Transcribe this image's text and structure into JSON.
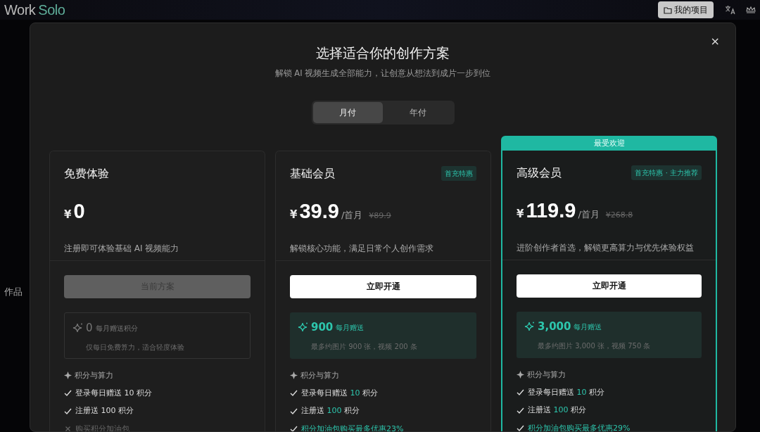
{
  "app": {
    "logo_word_1": "Work",
    "logo_word_2": "Solo",
    "projects_button": "我的项目",
    "side_label": "作品"
  },
  "dialog": {
    "title": "选择适合你的创作方案",
    "subtitle": "解锁 AI 视频生成全部能力，让创意从想法到成片一步到位",
    "close": "×"
  },
  "billing_tabs": [
    {
      "label": "月付",
      "selected": true
    },
    {
      "label": "年付",
      "selected": false
    }
  ],
  "plans": [
    {
      "name": "免费体验",
      "currency": "¥",
      "price": "0",
      "description": "注册即可体验基础 AI 视频能力",
      "button": {
        "label": "当前方案",
        "disabled": true
      },
      "credits": {
        "amount": "0",
        "label": "每月赠送积分",
        "note": "仅每日免费算力，适合轻度体验",
        "active": false
      },
      "features_heading": "积分与算力",
      "features": [
        {
          "kind": "included",
          "parts": [
            {
              "text": "登录每日赠送 10 积分",
              "highlight": false
            }
          ]
        },
        {
          "kind": "included",
          "parts": [
            {
              "text": "注册送 100 积分",
              "highlight": false
            }
          ]
        },
        {
          "kind": "excluded",
          "parts": [
            {
              "text": "购买积分加油包",
              "highlight": false
            }
          ]
        }
      ]
    },
    {
      "name": "基础会员",
      "badge": "首充特惠",
      "currency": "¥",
      "price": "39.9",
      "period": "/首月",
      "original_price": "¥89.9",
      "description": "解锁核心功能，满足日常个人创作需求",
      "button": {
        "label": "立即开通",
        "disabled": false
      },
      "credits": {
        "amount": "900",
        "label": "每月赠送",
        "note": "最多约图片 900 张，视频 200 条",
        "active": true
      },
      "features_heading": "积分与算力",
      "features": [
        {
          "kind": "included",
          "parts": [
            {
              "text": "登录每日赠送 ",
              "highlight": false
            },
            {
              "text": "10",
              "highlight": true
            },
            {
              "text": " 积分",
              "highlight": false
            }
          ]
        },
        {
          "kind": "included",
          "parts": [
            {
              "text": "注册送 ",
              "highlight": false
            },
            {
              "text": "100",
              "highlight": true
            },
            {
              "text": " 积分",
              "highlight": false
            }
          ]
        },
        {
          "kind": "included",
          "parts": [
            {
              "text": "积分加油包购买最多优惠23%",
              "highlight": true
            }
          ]
        }
      ]
    },
    {
      "name": "高级会员",
      "ribbon": "最受欢迎",
      "badge": "首充特惠 · 主力推荐",
      "currency": "¥",
      "price": "119.9",
      "period": "/首月",
      "original_price": "¥268.8",
      "description": "进阶创作者首选，解锁更高算力与优先体验权益",
      "button": {
        "label": "立即开通",
        "disabled": false
      },
      "credits": {
        "amount": "3,000",
        "label": "每月赠送",
        "note": "最多约图片 3,000 张，视频 750 条",
        "active": true
      },
      "features_heading": "积分与算力",
      "features": [
        {
          "kind": "included",
          "parts": [
            {
              "text": "登录每日赠送 ",
              "highlight": false
            },
            {
              "text": "10",
              "highlight": true
            },
            {
              "text": " 积分",
              "highlight": false
            }
          ]
        },
        {
          "kind": "included",
          "parts": [
            {
              "text": "注册送 ",
              "highlight": false
            },
            {
              "text": "100",
              "highlight": true
            },
            {
              "text": " 积分",
              "highlight": false
            }
          ]
        },
        {
          "kind": "included",
          "parts": [
            {
              "text": "积分加油包购买最多优惠29%",
              "highlight": true
            }
          ]
        }
      ]
    }
  ]
}
